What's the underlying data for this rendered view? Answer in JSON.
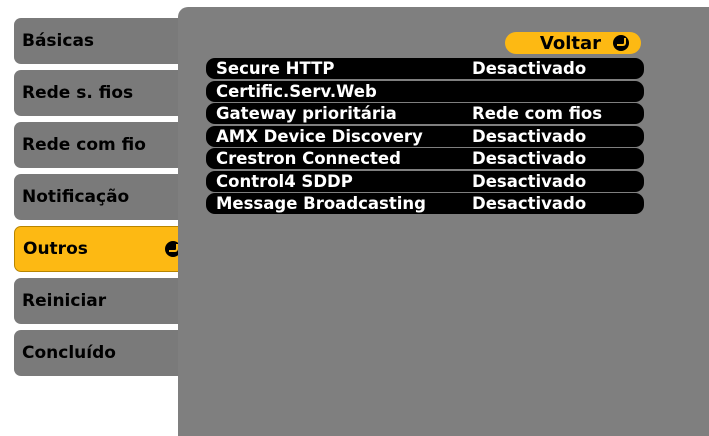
{
  "menu": {
    "items": [
      {
        "label": "Básicas"
      },
      {
        "label": "Rede s. fios"
      },
      {
        "label": "Rede com fio"
      },
      {
        "label": "Notificação"
      },
      {
        "label": "Outros"
      },
      {
        "label": "Reiniciar"
      },
      {
        "label": "Concluído"
      }
    ],
    "selected_index": 4
  },
  "back_button": {
    "label": "Voltar",
    "icon": "enter-icon"
  },
  "settings": [
    {
      "label": "Secure HTTP",
      "value": "Desactivado"
    },
    {
      "label": "Certific.Serv.Web",
      "value": ""
    },
    {
      "label": "Gateway prioritária",
      "value": "Rede com fios"
    },
    {
      "label": "AMX Device Discovery",
      "value": "Desactivado"
    },
    {
      "label": "Crestron Connected",
      "value": "Desactivado"
    },
    {
      "label": "Control4 SDDP",
      "value": "Desactivado"
    },
    {
      "label": "Message Broadcasting",
      "value": "Desactivado"
    }
  ],
  "colors": {
    "accent": "#fdb913",
    "tab": "#7a7a7a",
    "panel": "#7f7f7f",
    "row": "#000000",
    "text_on_row": "#ffffff"
  }
}
